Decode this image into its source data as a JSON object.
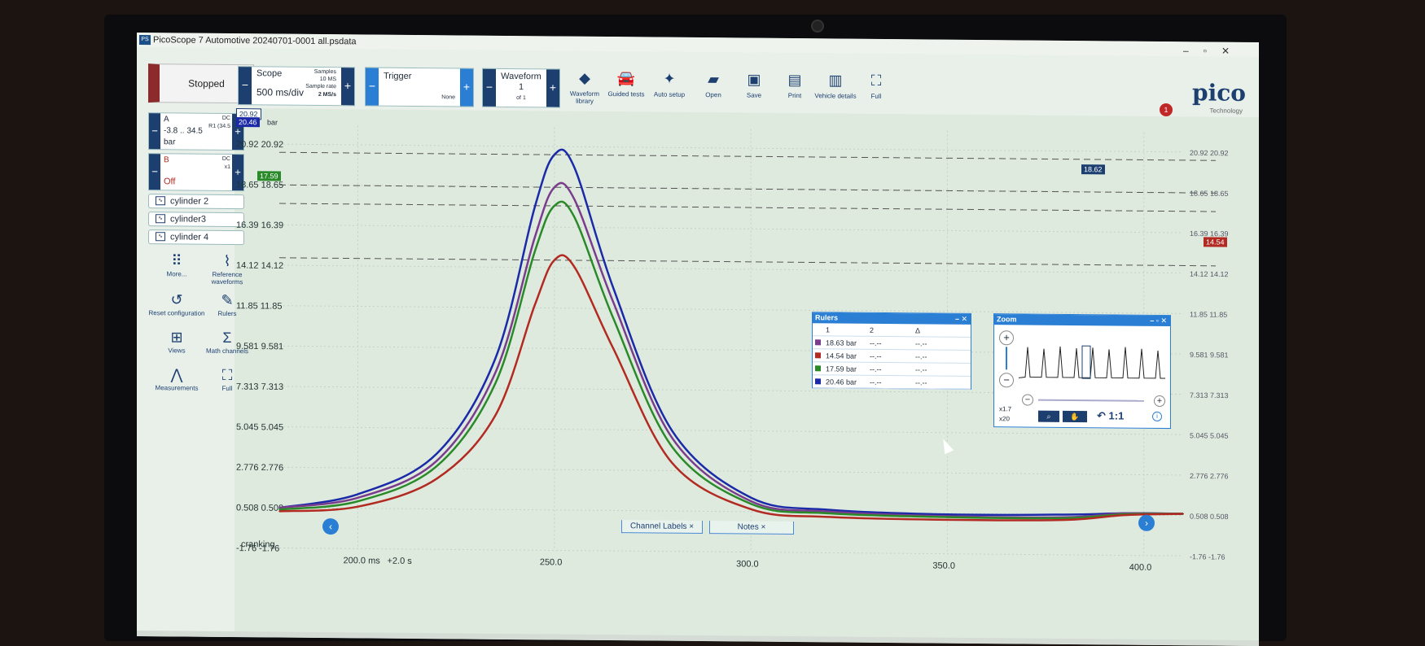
{
  "window": {
    "title": "PicoScope 7 Automotive 20240701-0001 all.psdata",
    "logo": "PS"
  },
  "status": {
    "label": "Stopped"
  },
  "scope": {
    "label": "Scope",
    "timebase": "500 ms/div",
    "samples_label": "Samples",
    "samples": "10 MS",
    "rate_label": "Sample rate",
    "rate": "2 MS/s"
  },
  "trigger": {
    "label": "Trigger",
    "mode": "None"
  },
  "waveform": {
    "label": "Waveform",
    "index": "1",
    "of": "of 1"
  },
  "toolbar": [
    {
      "label": "Waveform library",
      "icon": "waveform-library-icon",
      "glyph": "◆"
    },
    {
      "label": "Guided tests",
      "icon": "car-icon",
      "glyph": "🚘"
    },
    {
      "label": "Auto setup",
      "icon": "wand-icon",
      "glyph": "✦"
    },
    {
      "label": "Open",
      "icon": "folder-icon",
      "glyph": "▰"
    },
    {
      "label": "Save",
      "icon": "save-icon",
      "glyph": "▣"
    },
    {
      "label": "Print",
      "icon": "print-icon",
      "glyph": "▤"
    },
    {
      "label": "Vehicle details",
      "icon": "clipboard-icon",
      "glyph": "▥"
    },
    {
      "label": "Full",
      "icon": "fullscreen-icon",
      "glyph": "⛶"
    }
  ],
  "brand": {
    "name": "pico",
    "sub": "Technology",
    "notifications": "1"
  },
  "channels": {
    "a": {
      "name": "A",
      "coupling": "DC",
      "range": "-3.8 .. 34.5",
      "probe": "R1 (34.5",
      "unit": "bar"
    },
    "b": {
      "name": "B",
      "coupling": "DC",
      "probe": "x1",
      "state": "Off"
    }
  },
  "math_channels": [
    "cylinder 2",
    "cylinder3",
    "cylinder 4"
  ],
  "tools": [
    {
      "label": "More...",
      "icon": "grid-dots-icon",
      "glyph": "⠿"
    },
    {
      "label": "Reference waveforms",
      "icon": "reference-waveform-icon",
      "glyph": "⌇"
    },
    {
      "label": "Reset configuration",
      "icon": "reset-icon",
      "glyph": "↺"
    },
    {
      "label": "Rulers",
      "icon": "ruler-icon",
      "glyph": "✎"
    },
    {
      "label": "Views",
      "icon": "views-icon",
      "glyph": "⊞"
    },
    {
      "label": "Math channels",
      "icon": "sigma-icon",
      "glyph": "Σ"
    },
    {
      "label": "Measurements",
      "icon": "measurement-icon",
      "glyph": "⋀"
    },
    {
      "label": "Full",
      "icon": "fullscreen-icon",
      "glyph": "⛶"
    }
  ],
  "axis": {
    "y_ticks": [
      "20.92",
      "18.65",
      "16.39",
      "14.12",
      "11.85",
      "9.581",
      "7.313",
      "5.045",
      "2.776",
      "0.508",
      "-1.76"
    ],
    "unit": "bar",
    "x_ticks": [
      "200.0 ms",
      "250.0",
      "300.0",
      "350.0",
      "400.0"
    ],
    "x_offset": "+2.0 s"
  },
  "ruler_tags": {
    "top": "20.92",
    "r1": "20.46",
    "r2": "18.65",
    "r3": "17.59",
    "r4": "14.54",
    "right_r2": "18.62"
  },
  "rulers_panel": {
    "title": "Rulers",
    "headers": [
      "1",
      "2",
      "Δ"
    ],
    "rows": [
      {
        "c1": "18.63 bar",
        "c2": "--.--",
        "d": "--.--",
        "color": "#7a3c8c"
      },
      {
        "c1": "14.54 bar",
        "c2": "--.--",
        "d": "--.--",
        "color": "#b22a22"
      },
      {
        "c1": "17.59 bar",
        "c2": "--.--",
        "d": "--.--",
        "color": "#2a8a2a"
      },
      {
        "c1": "20.46 bar",
        "c2": "--.--",
        "d": "--.--",
        "color": "#1a2aa8"
      }
    ]
  },
  "zoom_panel": {
    "title": "Zoom",
    "x_zoom": "x1.7",
    "y_zoom": "x20",
    "reset": "1:1"
  },
  "bottom_tabs": [
    "Channel Labels",
    "Notes"
  ],
  "note_text": "cranking",
  "chart_data": {
    "type": "line",
    "x": [
      180,
      200,
      220,
      235,
      245,
      250,
      255,
      265,
      280,
      300,
      320,
      350,
      380,
      395,
      410
    ],
    "xlabel": "",
    "ylabel": "bar",
    "xlim": [
      180,
      410
    ],
    "ylim": [
      -1.76,
      22
    ],
    "series": [
      {
        "color": "#1a2aa8",
        "values": [
          0.5,
          1.3,
          3.6,
          9.0,
          17.5,
          20.46,
          19.8,
          13.0,
          5.0,
          1.3,
          0.65,
          0.45,
          0.5,
          0.6,
          0.6
        ]
      },
      {
        "color": "#7a3c8c",
        "values": [
          0.5,
          1.1,
          3.2,
          8.2,
          15.8,
          18.63,
          18.0,
          12.2,
          4.6,
          1.1,
          0.55,
          0.35,
          0.35,
          0.6,
          0.6
        ]
      },
      {
        "color": "#2a8a2a",
        "values": [
          0.4,
          0.9,
          2.9,
          7.6,
          15.0,
          17.59,
          17.0,
          11.3,
          4.1,
          0.95,
          0.45,
          0.3,
          0.3,
          0.55,
          0.6
        ]
      },
      {
        "color": "#b22a22",
        "values": [
          0.3,
          0.6,
          2.2,
          5.8,
          12.0,
          14.54,
          14.2,
          9.6,
          3.2,
          0.65,
          0.25,
          0.15,
          0.2,
          0.5,
          0.6
        ]
      }
    ]
  }
}
